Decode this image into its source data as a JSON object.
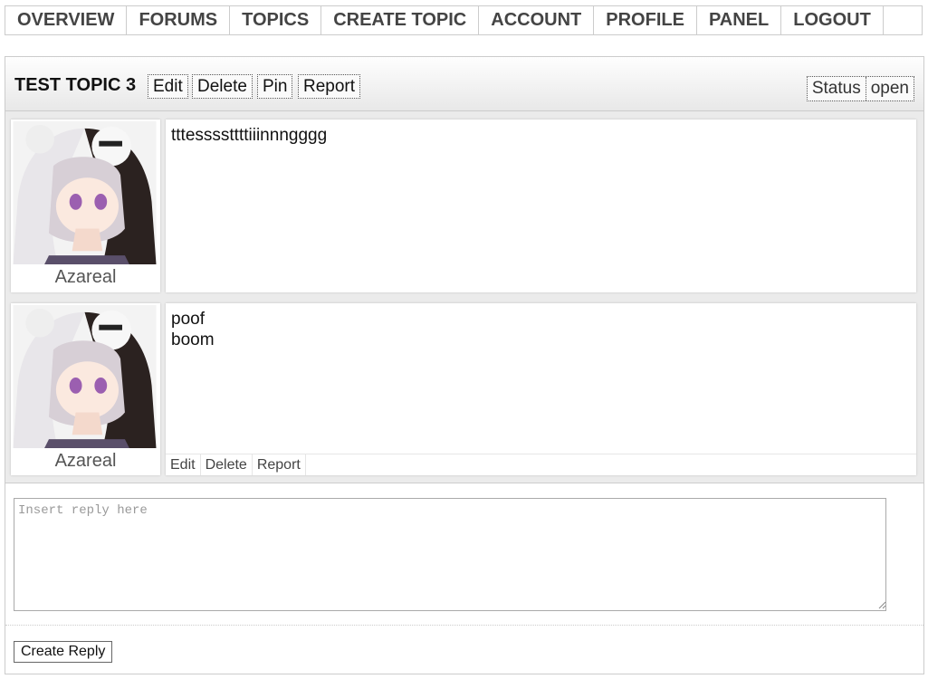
{
  "nav": {
    "items": [
      {
        "label": "OVERVIEW"
      },
      {
        "label": "FORUMS"
      },
      {
        "label": "TOPICS"
      },
      {
        "label": "CREATE TOPIC"
      },
      {
        "label": "ACCOUNT"
      },
      {
        "label": "PROFILE"
      },
      {
        "label": "PANEL"
      },
      {
        "label": "LOGOUT"
      }
    ]
  },
  "topic": {
    "title": "TEST TOPIC 3",
    "actions": {
      "edit": "Edit",
      "delete": "Delete",
      "pin": "Pin",
      "report": "Report"
    },
    "status_label": "Status",
    "status_value": "open"
  },
  "posts": [
    {
      "username": "Azareal",
      "avatar_icon": "anime-girl-bear-hood-avatar",
      "lines": [
        "tttessssttttiiinnngggg"
      ]
    },
    {
      "username": "Azareal",
      "avatar_icon": "anime-girl-bear-hood-avatar",
      "lines": [
        "poof",
        "boom"
      ],
      "actions": {
        "edit": "Edit",
        "delete": "Delete",
        "report": "Report"
      }
    }
  ],
  "reply": {
    "placeholder": "Insert reply here",
    "button_label": "Create Reply"
  }
}
